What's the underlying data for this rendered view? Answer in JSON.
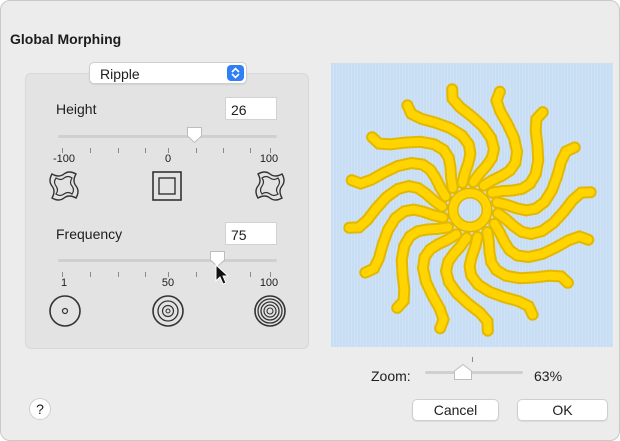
{
  "dialog": {
    "title": "Global Morphing"
  },
  "effect_popup": {
    "value": "Ripple"
  },
  "height": {
    "label": "Height",
    "value": "26",
    "tick_labels": [
      "-100",
      "0",
      "100"
    ],
    "level_percent": 63
  },
  "frequency": {
    "label": "Frequency",
    "value": "75",
    "tick_labels": [
      "1",
      "50",
      "100"
    ],
    "level_percent": 75
  },
  "zoom": {
    "label": "Zoom:",
    "value": "63%",
    "level_percent": 30
  },
  "buttons": {
    "help": "?",
    "cancel": "Cancel",
    "ok": "OK"
  },
  "colors": {
    "accent": "#2f7ff5",
    "preview_bg": "#cfe3f7",
    "design_fill": "#ffd400"
  },
  "icons": [
    "chevron-updown-icon",
    "morph-negative-icon",
    "morph-neutral-icon",
    "morph-positive-icon",
    "ripple-low-icon",
    "ripple-mid-icon",
    "ripple-high-icon",
    "cursor-pointer-icon"
  ]
}
